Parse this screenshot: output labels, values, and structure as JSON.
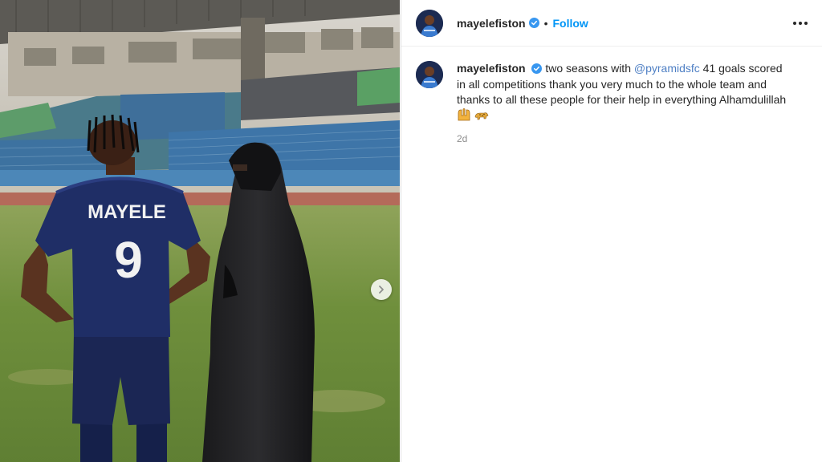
{
  "post": {
    "username": "mayelefiston",
    "follow_label": "Follow",
    "separator": "•",
    "caption_text": "two seasons with",
    "caption_mention": "@pyramidsfc",
    "caption_rest": "41 goals scored in all competitions thank you very much to the whole team and thanks to all these people for their help in everything Alhamdulillah",
    "timestamp": "2d",
    "emojis": [
      "hugging-hands-emoji",
      "leopard-emoji"
    ]
  },
  "photo": {
    "jersey_name": "MAYELE",
    "jersey_number": "9"
  },
  "colors": {
    "link": "#0095f6",
    "verified": "#3897f0",
    "text": "#262626",
    "muted": "#8e8e8e"
  }
}
